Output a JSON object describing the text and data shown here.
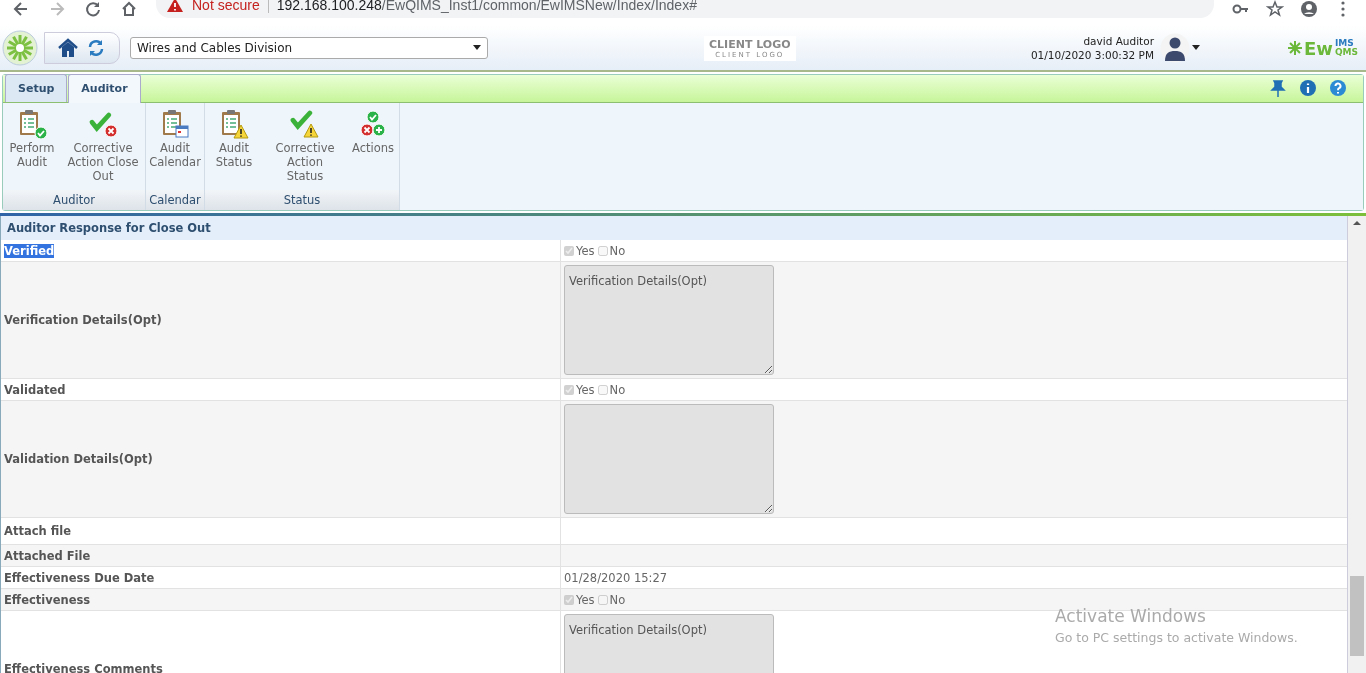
{
  "browser": {
    "security": "Not secure",
    "url_host": "192.168.100.248",
    "url_path": "/EwQIMS_Inst1/common/EwIMSNew/Index/Index#"
  },
  "header": {
    "division": "Wires and Cables Division",
    "client_logo": "CLIENT LOGO",
    "client_logo_sub": "CLIENT LOGO",
    "user": "david Auditor",
    "datetime": "01/10/2020 3:00:32 PM",
    "brand": "Ew",
    "brand_sup": "IMS",
    "brand_sub": "QMS"
  },
  "ribbon": {
    "tabs": [
      {
        "label": "Setup",
        "selected": false
      },
      {
        "label": "Auditor",
        "selected": true
      }
    ],
    "groups": [
      {
        "label": "Auditor",
        "items": [
          {
            "label": "Perform Audit",
            "kind": "clipboard-check"
          },
          {
            "label": "Corrective Action Close Out",
            "kind": "check-cross"
          }
        ]
      },
      {
        "label": "Calendar",
        "items": [
          {
            "label": "Audit Calendar",
            "kind": "clipboard-calendar"
          }
        ]
      },
      {
        "label": "Status",
        "items": [
          {
            "label": "Audit Status",
            "kind": "clipboard-warning"
          },
          {
            "label": "Corrective Action Status",
            "kind": "check-warning"
          },
          {
            "label": "Actions",
            "kind": "actions"
          }
        ]
      }
    ]
  },
  "form": {
    "title": "Auditor Response for Close Out",
    "rows": [
      {
        "label": "Verified",
        "kind": "yesno",
        "highlighted": true,
        "yes": "Yes",
        "no": "No",
        "yes_checked": true,
        "no_checked": false
      },
      {
        "label": "Verification Details(Opt)",
        "kind": "textarea",
        "highlighted": false,
        "placeholder": "Verification Details(Opt)"
      },
      {
        "label": "Validated",
        "kind": "yesno",
        "highlighted": false,
        "yes": "Yes",
        "no": "No",
        "yes_checked": true,
        "no_checked": false
      },
      {
        "label": "Validation Details(Opt)",
        "kind": "textarea",
        "highlighted": false
      },
      {
        "label": "Attach file",
        "kind": "blank",
        "highlighted": false
      },
      {
        "label": "Attached File",
        "kind": "blank",
        "highlighted": false
      },
      {
        "label": "Effectiveness Due Date",
        "kind": "text",
        "highlighted": false,
        "value": "01/28/2020 15:27"
      },
      {
        "label": "Effectiveness",
        "kind": "yesno",
        "highlighted": false,
        "yes": "Yes",
        "no": "No",
        "yes_checked": true,
        "no_checked": false
      },
      {
        "label": "Effectiveness Comments",
        "kind": "textarea",
        "highlighted": false,
        "placeholder": "Verification Details(Opt)"
      }
    ]
  },
  "os_notice": {
    "title": "Activate Windows",
    "text": "Go to PC settings to activate Windows."
  }
}
